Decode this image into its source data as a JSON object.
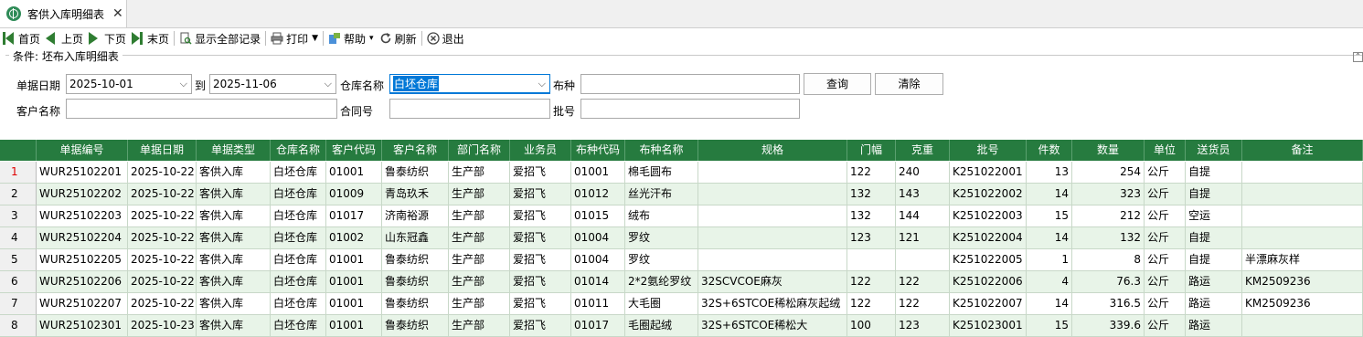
{
  "tab": {
    "title": "客供入库明细表",
    "close": "✕"
  },
  "toolbar": {
    "first": "首页",
    "prev": "上页",
    "next": "下页",
    "last": "末页",
    "show_all": "显示全部记录",
    "print": "打印",
    "help": "帮助",
    "refresh": "刷新",
    "exit": "退出"
  },
  "condition": {
    "group_title": "条件: 坯布入库明细表",
    "date_label": "单据日期",
    "date_from": "2025-10-01",
    "to_label": "到",
    "date_to": "2025-11-06",
    "warehouse_label": "仓库名称",
    "warehouse_value": "白坯仓库",
    "fabric_label": "布种",
    "fabric_value": "",
    "customer_label": "客户名称",
    "customer_value": "",
    "contract_label": "合同号",
    "contract_value": "",
    "batch_label": "批号",
    "batch_value": "",
    "query_button": "查询",
    "clear_button": "清除"
  },
  "grid": {
    "columns": [
      "单据编号",
      "单据日期",
      "单据类型",
      "仓库名称",
      "客户代码",
      "客户名称",
      "部门名称",
      "业务员",
      "布种代码",
      "布种名称",
      "规格",
      "门幅",
      "克重",
      "批号",
      "件数",
      "数量",
      "单位",
      "送货员",
      "备注"
    ],
    "rows": [
      [
        "1",
        "WUR25102201",
        "2025-10-22",
        "客供入库",
        "白坯仓库",
        "01001",
        "鲁泰纺织",
        "生产部",
        "爱招飞",
        "01001",
        "棉毛圆布",
        "",
        "122",
        "240",
        "K251022001",
        "13",
        "254",
        "公斤",
        "自提",
        ""
      ],
      [
        "2",
        "WUR25102202",
        "2025-10-22",
        "客供入库",
        "白坯仓库",
        "01009",
        "青岛玖禾",
        "生产部",
        "爱招飞",
        "01012",
        "丝光汗布",
        "",
        "132",
        "143",
        "K251022002",
        "14",
        "323",
        "公斤",
        "自提",
        ""
      ],
      [
        "3",
        "WUR25102203",
        "2025-10-22",
        "客供入库",
        "白坯仓库",
        "01017",
        "济南裕源",
        "生产部",
        "爱招飞",
        "01015",
        "绒布",
        "",
        "132",
        "144",
        "K251022003",
        "15",
        "212",
        "公斤",
        "空运",
        ""
      ],
      [
        "4",
        "WUR25102204",
        "2025-10-22",
        "客供入库",
        "白坯仓库",
        "01002",
        "山东冠鑫",
        "生产部",
        "爱招飞",
        "01004",
        "罗纹",
        "",
        "123",
        "121",
        "K251022004",
        "14",
        "132",
        "公斤",
        "自提",
        ""
      ],
      [
        "5",
        "WUR25102205",
        "2025-10-22",
        "客供入库",
        "白坯仓库",
        "01001",
        "鲁泰纺织",
        "生产部",
        "爱招飞",
        "01004",
        "罗纹",
        "",
        "",
        "",
        "K251022005",
        "1",
        "8",
        "公斤",
        "自提",
        "半漂麻灰样"
      ],
      [
        "6",
        "WUR25102206",
        "2025-10-22",
        "客供入库",
        "白坯仓库",
        "01001",
        "鲁泰纺织",
        "生产部",
        "爱招飞",
        "01014",
        "2*2氨纶罗纹",
        "32SCVCOE麻灰",
        "122",
        "122",
        "K251022006",
        "4",
        "76.3",
        "公斤",
        "路运",
        "KM2509236"
      ],
      [
        "7",
        "WUR25102207",
        "2025-10-22",
        "客供入库",
        "白坯仓库",
        "01001",
        "鲁泰纺织",
        "生产部",
        "爱招飞",
        "01011",
        "大毛圈",
        "32S+6STCOE稀松麻灰起绒",
        "122",
        "122",
        "K251022007",
        "14",
        "316.5",
        "公斤",
        "路运",
        "KM2509236"
      ],
      [
        "8",
        "WUR25102301",
        "2025-10-23",
        "客供入库",
        "白坯仓库",
        "01001",
        "鲁泰纺织",
        "生产部",
        "爱招飞",
        "01017",
        "毛圈起绒",
        "32S+6STCOE稀松大",
        "100",
        "123",
        "K251023001",
        "15",
        "339.6",
        "公斤",
        "路运",
        ""
      ]
    ]
  },
  "colors": {
    "header_bg": "#267b3f",
    "row_even": "#e8f4e8",
    "row_odd": "#ffffff",
    "row_number_active": "#e00000"
  }
}
